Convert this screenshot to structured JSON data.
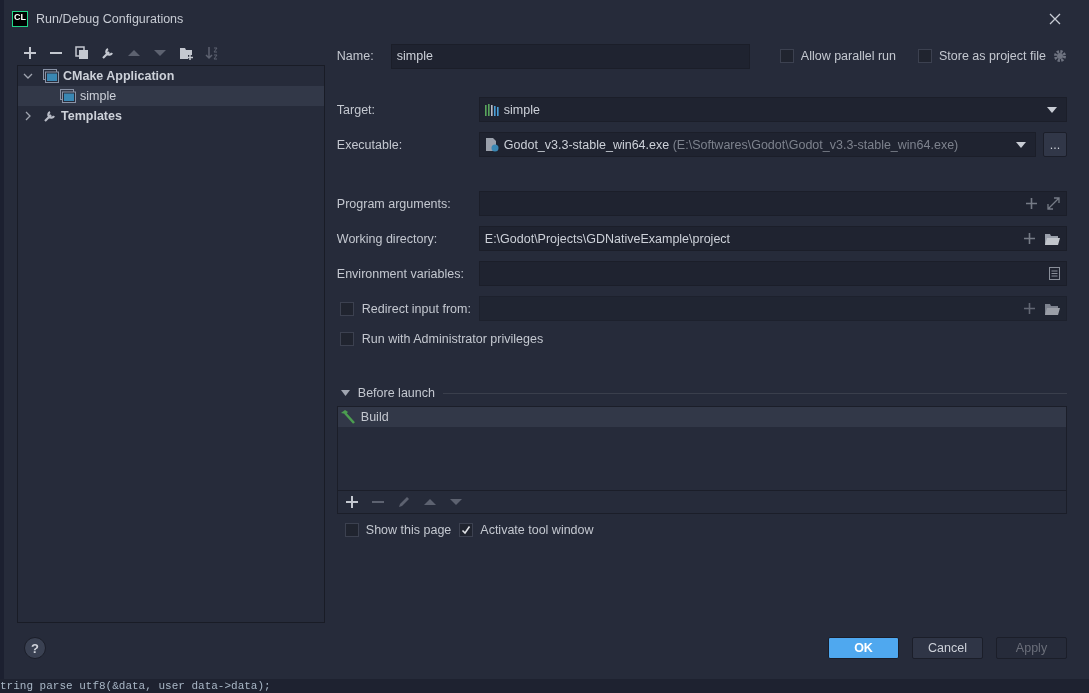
{
  "window": {
    "title": "Run/Debug Configurations",
    "logo": "CL"
  },
  "toolbar": [
    {
      "kind": "add",
      "disabled": false
    },
    {
      "kind": "remove",
      "disabled": false
    },
    {
      "kind": "copy",
      "disabled": false
    },
    {
      "kind": "wrench",
      "disabled": false
    },
    {
      "kind": "up",
      "disabled": true
    },
    {
      "kind": "down",
      "disabled": true
    },
    {
      "kind": "folder",
      "disabled": false
    },
    {
      "kind": "sort",
      "disabled": true
    }
  ],
  "tree": [
    {
      "label": "CMake Application",
      "kind": "app",
      "expanded": true,
      "selected": false,
      "children": [
        {
          "label": "simple",
          "kind": "app",
          "selected": true
        }
      ]
    },
    {
      "label": "Templates",
      "kind": "wrench",
      "expanded": false,
      "selected": false
    }
  ],
  "name_field": {
    "label": "Name:",
    "value": "simple"
  },
  "options": [
    {
      "label": "Allow parallel run",
      "checked": false,
      "kind": "plain"
    },
    {
      "label": "Store as project file",
      "checked": false,
      "kind": "gear"
    }
  ],
  "target": {
    "label": "Target:",
    "value": "simple"
  },
  "executable": {
    "label": "Executable:",
    "value": "Godot_v3.3-stable_win64.exe",
    "path": "(E:\\Softwares\\Godot\\Godot_v3.3-stable_win64.exe)",
    "browse": "..."
  },
  "fields": [
    {
      "label": "Program arguments:",
      "kind": "args"
    },
    {
      "label": "Working directory:",
      "kind": "dir",
      "value": "E:\\Godot\\Projects\\GDNativeExample\\project"
    },
    {
      "label": "Environment variables:",
      "kind": "env"
    },
    {
      "label": "Redirect input from:",
      "kind": "redirect",
      "checked": false
    }
  ],
  "admin": {
    "label": "Run with Administrator privileges",
    "checked": false
  },
  "before_launch": {
    "title": "Before launch",
    "expanded": true,
    "tasks": [
      {
        "label": "Build",
        "selected": true
      }
    ],
    "toolbar": [
      {
        "kind": "add",
        "disabled": false
      },
      {
        "kind": "remove",
        "disabled": true
      },
      {
        "kind": "edit",
        "disabled": true
      },
      {
        "kind": "up",
        "disabled": true
      },
      {
        "kind": "down",
        "disabled": true
      }
    ]
  },
  "launch_options": [
    {
      "label": "Show this page",
      "checked": false
    },
    {
      "label": "Activate tool window",
      "checked": true
    }
  ],
  "help": "?",
  "buttons": [
    {
      "label": "OK",
      "kind": "primary",
      "disabled": false
    },
    {
      "label": "Cancel",
      "kind": "normal",
      "disabled": false
    },
    {
      "label": "Apply",
      "kind": "normal",
      "disabled": true
    }
  ],
  "background_code": "tring parse utf8(&data, user data->data);"
}
